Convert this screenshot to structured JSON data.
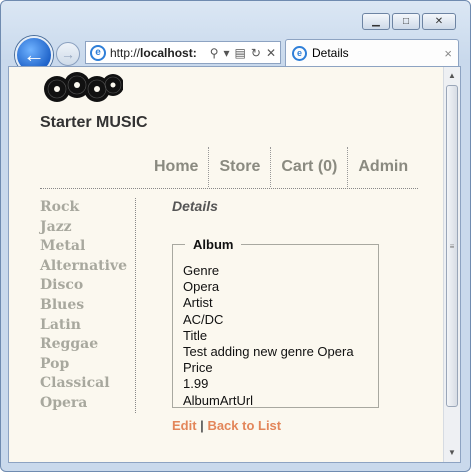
{
  "browser": {
    "address": {
      "prefix": "http://",
      "host": "localhost:"
    },
    "tab": {
      "title": "Details",
      "close": "×"
    }
  },
  "site": {
    "title": "Starter MUSIC"
  },
  "menu": [
    "Home",
    "Store",
    "Cart (0)",
    "Admin"
  ],
  "genres": [
    "Rock",
    "Jazz",
    "Metal",
    "Alternative",
    "Disco",
    "Blues",
    "Latin",
    "Reggae",
    "Pop",
    "Classical",
    "Opera"
  ],
  "page": {
    "heading": "Details",
    "legend": "Album",
    "fields": [
      "Genre",
      "Opera",
      "Artist",
      "AC/DC",
      "Title",
      "Test adding new genre Opera",
      "Price",
      "1.99",
      "AlbumArtUrl"
    ]
  },
  "actions": {
    "edit": "Edit",
    "separator": " | ",
    "back": "Back to List"
  },
  "colors": {
    "link": "#e3865a",
    "genre": "#a8a89e",
    "menu": "#8a8a80",
    "page_bg": "#fbf8ef"
  }
}
